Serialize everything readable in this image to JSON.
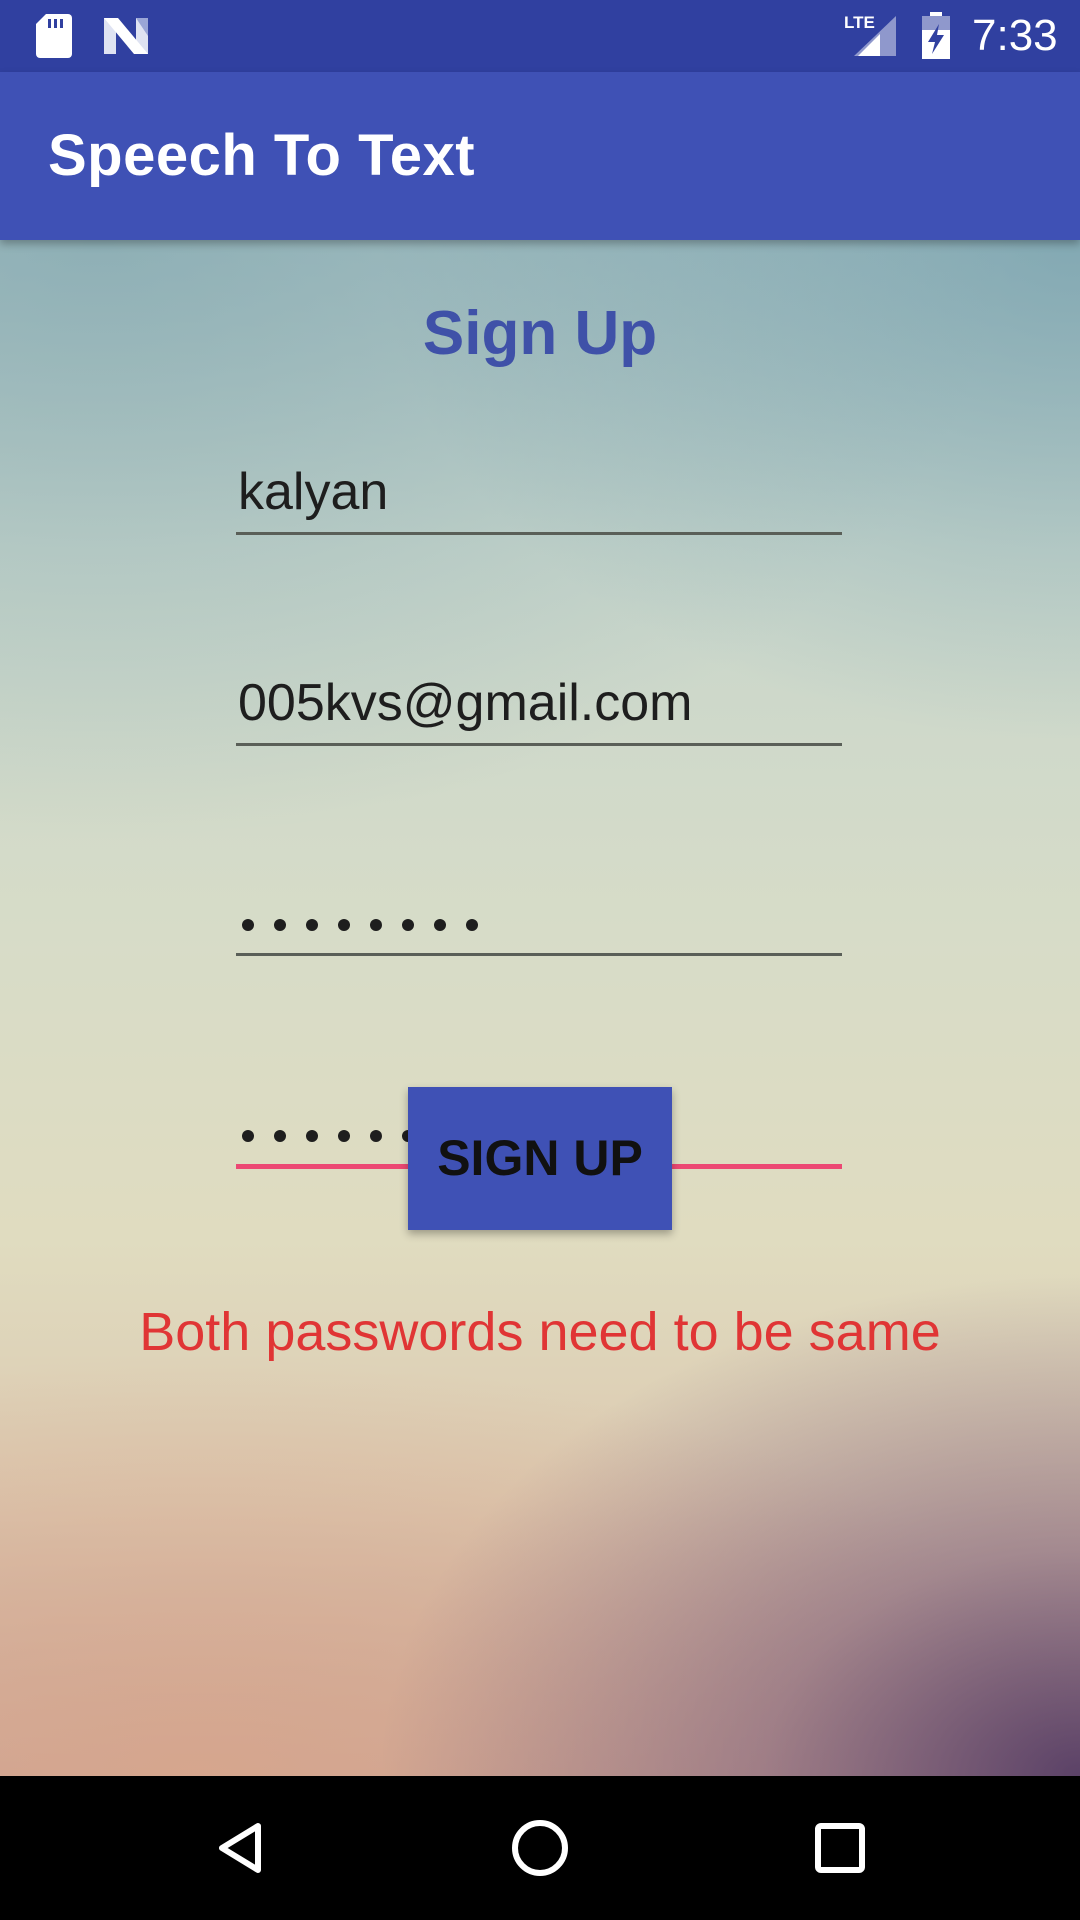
{
  "status_bar": {
    "time": "7:33",
    "network_label": "LTE",
    "icons": [
      "sd-card-icon",
      "n-logo-icon",
      "lte-signal-icon",
      "battery-charging-icon"
    ]
  },
  "app_bar": {
    "title": "Speech To Text",
    "color": "#3f51b5"
  },
  "form": {
    "heading": "Sign Up",
    "username_value": "kalyan",
    "email_value": "005kvs@gmail.com",
    "password_mask": "••••••••",
    "confirm_password_mask": "••••••••",
    "signup_button_label": "SIGN UP",
    "error_message": "Both passwords need to be same",
    "error_color": "#e03535",
    "focus_color": "#ec4873"
  },
  "nav_bar": {
    "buttons": [
      "back-icon",
      "home-icon",
      "recents-icon"
    ]
  }
}
